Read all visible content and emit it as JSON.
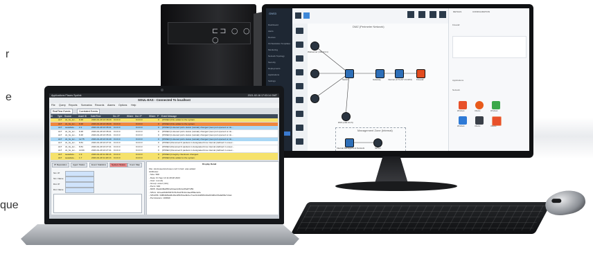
{
  "side_text": [
    "r",
    "e",
    "que"
  ],
  "desktop": {
    "sidebar": {
      "logo": "GNS3",
      "items": [
        "Dashboard",
        "Alerts",
        "Devices",
        "Orchestration Templates",
        "Monitoring",
        "Network Topology",
        "Security",
        "Deployments",
        "Applications",
        "Settings",
        "Support",
        "Manage users"
      ]
    },
    "canvas": {
      "title": "DMZ (Perimeter Network)",
      "lan_title": "Management Zone (Internal)",
      "nodes": [
        "Webserver (192.0.0.1)",
        "Switch",
        "Gateway",
        "Internet (173.217.13.0/24)",
        "Firewall",
        "DNS (192.0.0.5)",
        "Internal Management Network",
        "Server"
      ]
    },
    "props": {
      "tabs": [
        "DETAILS",
        "CONFIGURATION"
      ],
      "sections": [
        "Firewall",
        "Applications",
        "Network"
      ],
      "apps": [
        "Windows",
        "Ubuntu",
        "Windows",
        "Ubuntu",
        "Windows",
        "Ubuntu"
      ]
    }
  },
  "laptop": {
    "os_bar": {
      "left": "Applications  Places  Syslink",
      "right": "2021-02-16  17:03:14 GMT"
    },
    "window_title": "SOUL-EAS - Connected To localhost",
    "menu": [
      "File",
      "Query",
      "Reports",
      "Scenarios",
      "Records",
      "Alarms",
      "Options",
      "Help"
    ],
    "tabs": [
      "RealTime Events",
      "Correlated Events"
    ],
    "columns": [
      "ID",
      "Type",
      "Source",
      "Asset ID",
      "Date/Time",
      "Src. IP",
      "Where",
      "Dst. IP",
      "Where",
      "P",
      "Event Message"
    ],
    "rows": [
      {
        "type": "ALT",
        "source": "dc_fw_loc...",
        "asset": "8.48",
        "time": "2023-01-28 23:38:29",
        "src": "0.0.0.0",
        "dst": "0.0.0.0",
        "p": "0",
        "msg": "[OSSEC] File added to the system.",
        "color": "#f6e26b"
      },
      {
        "type": "ALT",
        "source": "dc_fw_loc...",
        "asset": "8.48",
        "time": "2023-01-28 23:38:29",
        "src": "0.0.0.0",
        "dst": "0.0.0.0",
        "p": "0",
        "msg": "[OSSEC] File added to the system.",
        "color": "#f0873c"
      },
      {
        "type": "ALT",
        "source": "seasdate...",
        "asset": "2.1",
        "time": "2023-01-28 23:35:41",
        "src": "0.0.0.0",
        "dst": "0.0.0.0",
        "p": "0",
        "msg": "[OSSEC] Listened ports status (netstat) changed (new port opened or clo...",
        "color": "#a9d7f5"
      },
      {
        "type": "ALT",
        "source": "dc_fw_loc...",
        "asset": "8.48",
        "time": "2023-01-28 23:35:41",
        "src": "0.0.0.0",
        "dst": "0.0.0.0",
        "p": "0",
        "msg": "[OSSEC] Listened ports status (netstat) changed (new port opened or clo...",
        "color": "#ffffff"
      },
      {
        "type": "ALT",
        "source": "dc_fw_loc...",
        "asset": "8.48",
        "time": "2023-01-28 23:35:41",
        "src": "0.0.0.0",
        "dst": "0.0.0.0",
        "p": "0",
        "msg": "[OSSEC] Listened ports status (netstat) changed (new port opened or clo...",
        "color": "#ffffff"
      },
      {
        "type": "ALT",
        "source": "dc_fw_loc...",
        "asset": "12.75",
        "time": "2023-01-28 23:34:49",
        "src": "0.0.0.0",
        "dst": "0.0.0.0",
        "p": "0",
        "msg": "[OSSEC] Listened ports status (netstat) changed (new port opened or clo...",
        "color": "#a9d7f5"
      },
      {
        "type": "ALT",
        "source": "dc_fw_loc...",
        "asset": "8.81",
        "time": "2023-01-28 23:27:41",
        "src": "0.0.0.0",
        "dst": "0.0.0.0",
        "p": "0",
        "msg": "[OSSEC] Received 0 packets in designated time interval (defined in ossec...",
        "color": "#ffffff"
      },
      {
        "type": "ALT",
        "source": "dc_fw_loc...",
        "asset": "8.81",
        "time": "2023-01-28 23:27:41",
        "src": "0.0.0.0",
        "dst": "0.0.0.0",
        "p": "0",
        "msg": "[OSSEC] Received 0 packets in designated time interval (defined in ossec...",
        "color": "#ffffff"
      },
      {
        "type": "ALT",
        "source": "dc_fw_loc...",
        "asset": "10.69",
        "time": "2023-01-28 23:27:41",
        "src": "0.0.0.0",
        "dst": "0.0.0.0",
        "p": "0",
        "msg": "[OSSEC] Received 0 packets in designated time interval (defined in ossec...",
        "color": "#ffffff"
      },
      {
        "type": "ALT",
        "source": "seasdate...",
        "asset": "1.9",
        "time": "2023-01-28 11:36:16",
        "src": "0.0.0.0",
        "dst": "0.0.0.0",
        "p": "0",
        "msg": "[OSSEC] Integrity checksum changed.",
        "color": "#f6e26b"
      },
      {
        "type": "ALT",
        "source": "seasdate...",
        "asset": "1.7",
        "time": "2023-01-28 11:20:13",
        "src": "0.0.0.0",
        "dst": "0.0.0.0",
        "p": "0",
        "msg": "[OSSEC] File added to the system.",
        "color": "#f6e26b"
      }
    ],
    "bottom_tabs": [
      "IP Reputation",
      "Agent Status",
      "Event Statistics",
      "System Status",
      "Users Map"
    ],
    "filter_labels": [
      "Src. IP",
      "Src. Name",
      "Dst. IP",
      "Dst. Name"
    ],
    "detail_title": "Display Detail",
    "detail_lines": [
      "File: /etc/ossec/etc/ossec.conf in fact: was added",
      "Attributes:",
      " - Size: 568",
      " - Date: Fri Sep 10 11:28:28 2023",
      " - User: root (0)",
      " - Group: ossec (111)",
      " - Perm: 640",
      " - MD5: 3ba42d9a9501e91ae4c4b2e1f9e87d59",
      " - SHA1: 101ea3f44b5f07b76c61d7fb41c4ae4f59e4a7e",
      " - SHA256: 34f8b8d5ab8c46ef25bf31a49c1e71ec0c4d29f8c40e0f2d0b2c5a9a58e7c4a1",
      " - Permissions: 100640"
    ]
  }
}
